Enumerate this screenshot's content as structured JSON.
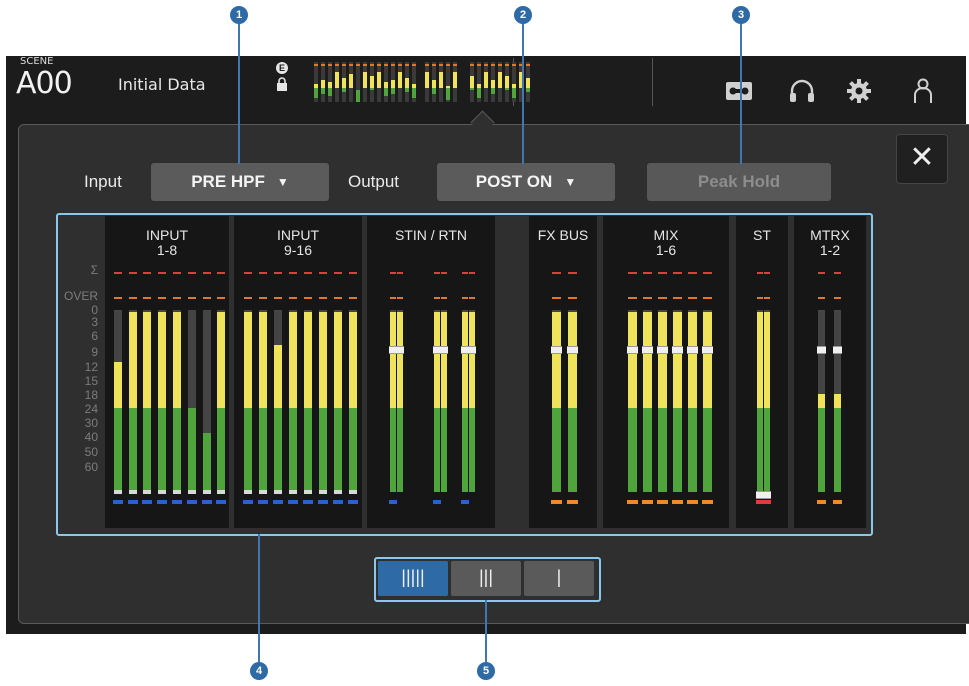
{
  "header": {
    "scene_label": "SCENE",
    "scene_number": "A00",
    "scene_title": "Initial Data",
    "edit_badge": "E",
    "icons": [
      "lock-icon",
      "recorder-icon",
      "headphones-icon",
      "gear-icon",
      "user-icon"
    ]
  },
  "controls": {
    "input_label": "Input",
    "input_value": "PRE HPF",
    "output_label": "Output",
    "output_value": "POST ON",
    "peak_hold_label": "Peak Hold",
    "close_symbol": "✕"
  },
  "meters": {
    "scale_labels": [
      "Σ",
      "OVER",
      "0",
      "3",
      "6",
      "9",
      "12",
      "15",
      "18",
      "24",
      "30",
      "40",
      "50",
      "60"
    ],
    "groups": [
      {
        "title": "INPUT\n1-8",
        "levels": [
          0.62,
          0.86,
          0.86,
          0.86,
          0.86,
          0.4,
          0.28,
          0.86
        ],
        "fader": null
      },
      {
        "title": "INPUT\n9-16",
        "levels": [
          0.86,
          0.86,
          0.7,
          0.86,
          0.86,
          0.86,
          0.86,
          0.86
        ],
        "fader": null
      },
      {
        "title": "STIN / RTN",
        "levels": [
          0.86,
          0.86,
          0.86,
          0.86,
          0.86,
          0.86
        ],
        "fader": 0.82
      },
      {
        "title": "FX BUS",
        "levels": [
          0.86,
          0.86
        ],
        "fader": 0.82
      },
      {
        "title": "MIX\n1-6",
        "levels": [
          0.86,
          0.86,
          0.86,
          0.86,
          0.86,
          0.86
        ],
        "fader": 0.82
      },
      {
        "title": "ST",
        "levels": [
          0.86,
          0.86
        ],
        "fader": 0.0
      },
      {
        "title": "MTRX\n1-2",
        "levels": [
          0.47,
          0.47
        ],
        "fader": 0.82
      }
    ]
  },
  "mode_buttons": [
    {
      "label": "|||||",
      "selected": true
    },
    {
      "label": "|||",
      "selected": false
    },
    {
      "label": "|",
      "selected": false
    }
  ],
  "callouts": [
    "1",
    "2",
    "3",
    "4",
    "5"
  ],
  "colors": {
    "accent": "#2e6aa6",
    "meter_green": "#4fa53c",
    "meter_yellow": "#efe35b",
    "peak_red": "#e23a3a",
    "peak_orange": "#f08a28",
    "bottom_blue": "#2c5fd1"
  }
}
